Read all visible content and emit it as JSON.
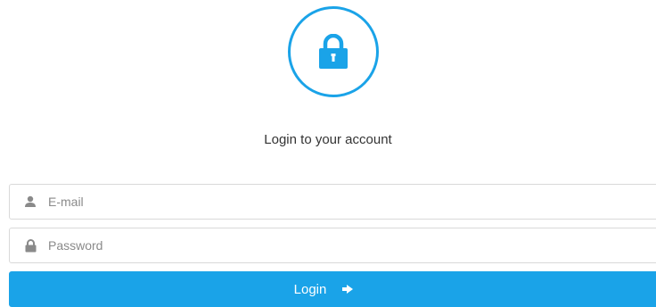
{
  "header": {
    "logo_icon": "lock-icon",
    "subtitle": "Login to your account"
  },
  "form": {
    "email": {
      "icon": "user-icon",
      "placeholder": "E-mail",
      "value": ""
    },
    "password": {
      "icon": "lock-icon",
      "placeholder": "Password",
      "value": ""
    },
    "login_button": {
      "label": "Login",
      "icon": "arrow-right-icon"
    }
  },
  "colors": {
    "accent": "#1aa3e8",
    "text": "#333333",
    "placeholder": "#8a8a8a",
    "border": "#d9d9d9"
  }
}
